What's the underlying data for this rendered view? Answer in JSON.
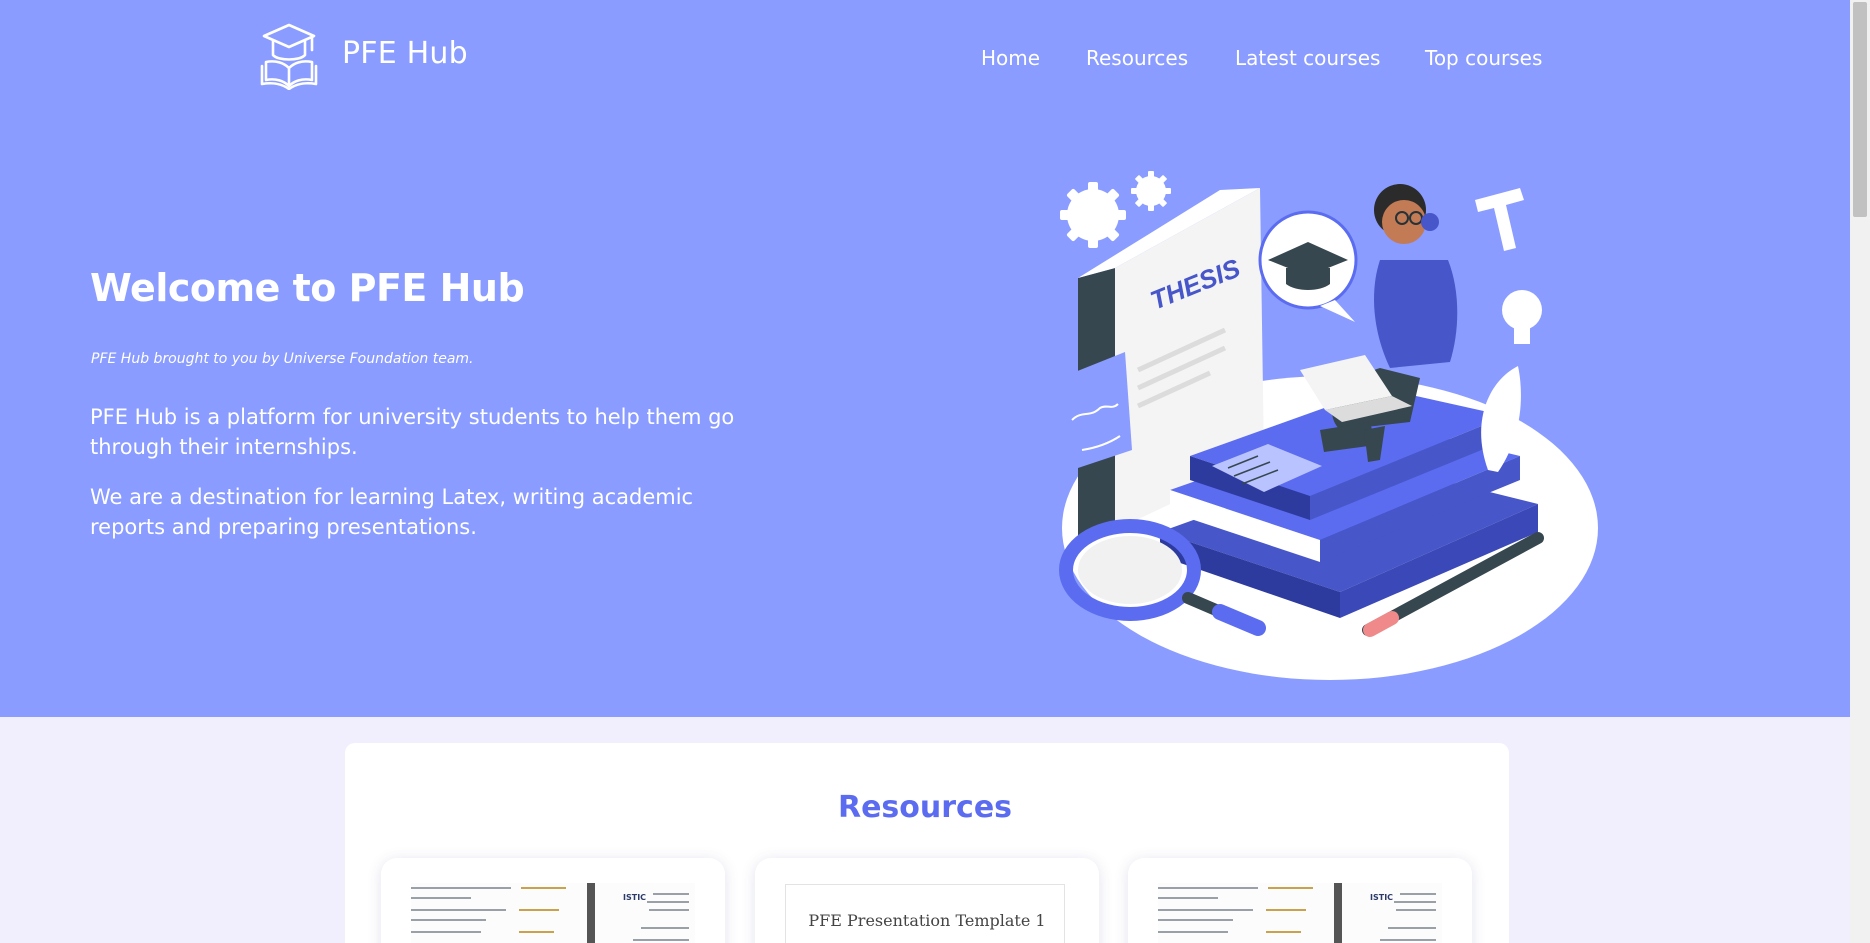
{
  "colors": {
    "hero_bg": "#8a9cff",
    "accent": "#5b6cf0",
    "page_bg": "#f1effd"
  },
  "nav": {
    "brand": "PFE Hub",
    "logo_icon": "graduation-cap-book-icon",
    "links": [
      "Home",
      "Resources",
      "Latest courses",
      "Top courses"
    ]
  },
  "hero": {
    "title": "Welcome to PFE Hub",
    "subtitle": "PFE Hub brought to you by Universe Foundation team.",
    "paragraphs": [
      "PFE Hub is a platform for university students to help them go through their internships.",
      "We are a destination for learning Latex, writing academic reports and preparing presentations."
    ],
    "illustration_text": "THESIS"
  },
  "resources": {
    "title": "Resources",
    "cards": [
      {
        "type": "latex-report-template",
        "logo": "ISTIC"
      },
      {
        "type": "presentation-template",
        "title": "PFE Presentation Template 1"
      },
      {
        "type": "latex-report-template",
        "logo": "ISTIC"
      }
    ]
  }
}
